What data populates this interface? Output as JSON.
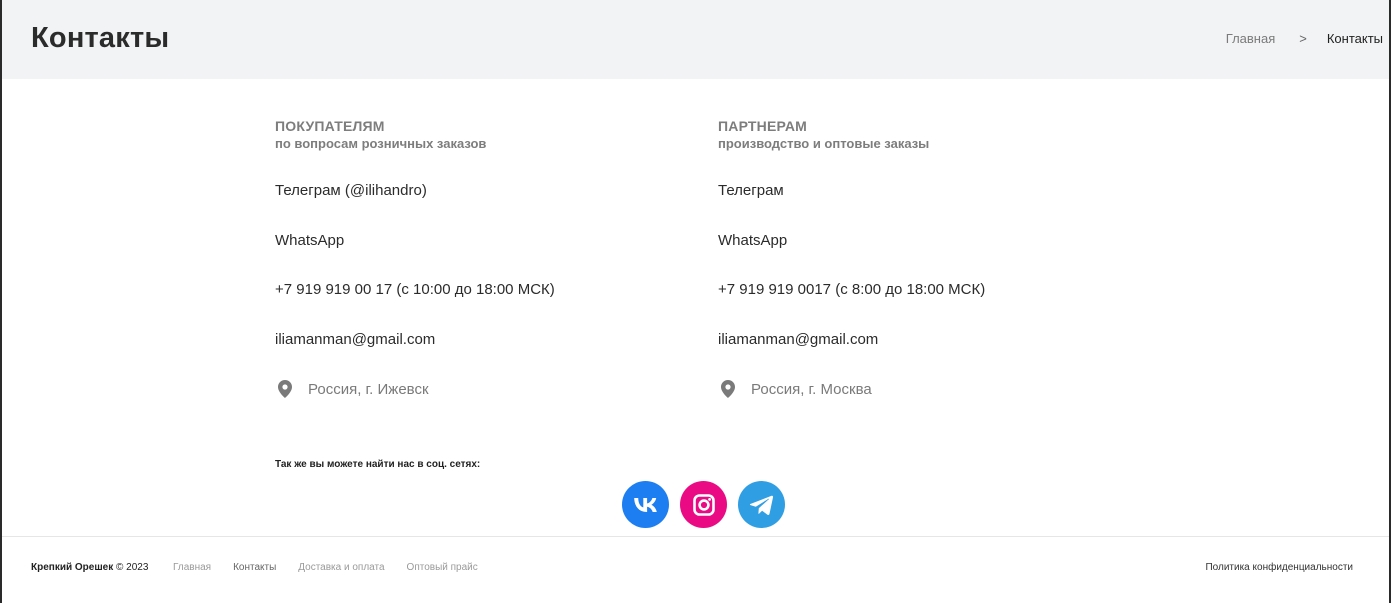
{
  "header": {
    "title": "Контакты",
    "breadcrumb": {
      "home": "Главная",
      "separator": ">",
      "current": "Контакты"
    }
  },
  "buyers": {
    "title": "ПОКУПАТЕЛЯМ",
    "subtitle": "по вопросам розничных заказов",
    "telegram": "Телеграм (@ilihandro)",
    "whatsapp": "WhatsApp",
    "phone": "+7 919 919 00 17 (с 10:00 до 18:00 МСК)",
    "email": "iliamanman@gmail.com",
    "location": "Россия, г. Ижевск"
  },
  "partners": {
    "title": "ПАРТНЕРАМ",
    "subtitle": "производство и оптовые заказы",
    "telegram": "Телеграм",
    "whatsapp": "WhatsApp",
    "phone": "+7 919 919 0017 (с 8:00 до 18:00 МСК)",
    "email": "iliamanman@gmail.com",
    "location": "Россия, г. Москва"
  },
  "social": {
    "caption": "Так же вы можете найти нас в соц. сетях:",
    "icons": [
      "vk-icon",
      "instagram-icon",
      "telegram-icon"
    ],
    "colors": {
      "vk": "#1c7ef0",
      "instagram": "#ea0a84",
      "telegram": "#2f9ee3"
    }
  },
  "footer": {
    "brand": "Крепкий Орешек",
    "copyright": "© 2023",
    "nav": {
      "home": "Главная",
      "contacts": "Контакты",
      "delivery": "Доставка и оплата",
      "pricelist": "Оптовый прайс"
    },
    "policy": "Политика конфиденциальности"
  }
}
